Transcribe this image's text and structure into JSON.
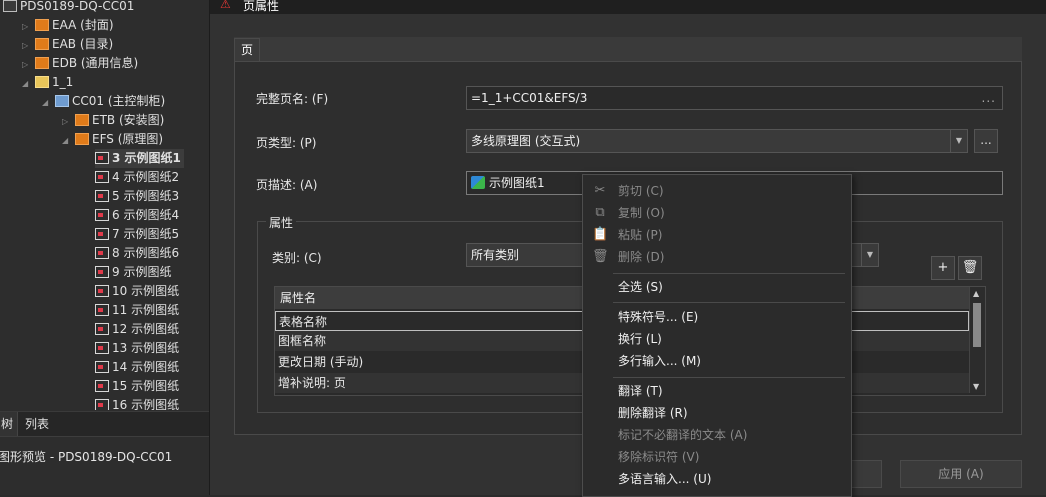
{
  "tree": {
    "nodes": [
      {
        "label": "PDS0189-DQ-CC01",
        "icon": "root-icon",
        "indent": 0,
        "arrow": ""
      },
      {
        "label": "EAA (封面)",
        "icon": "folder-icon",
        "indent": 1,
        "arrow": "▷"
      },
      {
        "label": "EAB (目录)",
        "icon": "folder-icon",
        "indent": 1,
        "arrow": "▷"
      },
      {
        "label": "EDB (通用信息)",
        "icon": "folder-icon",
        "indent": 1,
        "arrow": "▷"
      },
      {
        "label": "1_1",
        "icon": "group-icon",
        "indent": 1,
        "arrow": "◢"
      },
      {
        "label": "CC01 (主控制柜)",
        "icon": "blue-icon",
        "indent": 2,
        "arrow": "◢"
      },
      {
        "label": "ETB (安装图)",
        "icon": "folder-icon",
        "indent": 3,
        "arrow": "▷"
      },
      {
        "label": "EFS (原理图)",
        "icon": "folder-icon",
        "indent": 3,
        "arrow": "◢"
      },
      {
        "label": "3 示例图纸1",
        "icon": "page-icon",
        "indent": 4,
        "arrow": "",
        "selected": true
      },
      {
        "label": "4 示例图纸2",
        "icon": "page-icon",
        "indent": 4,
        "arrow": ""
      },
      {
        "label": "5 示例图纸3",
        "icon": "page-icon",
        "indent": 4,
        "arrow": ""
      },
      {
        "label": "6 示例图纸4",
        "icon": "page-icon",
        "indent": 4,
        "arrow": ""
      },
      {
        "label": "7 示例图纸5",
        "icon": "page-icon",
        "indent": 4,
        "arrow": ""
      },
      {
        "label": "8 示例图纸6",
        "icon": "page-icon",
        "indent": 4,
        "arrow": ""
      },
      {
        "label": "9 示例图纸",
        "icon": "page-icon",
        "indent": 4,
        "arrow": ""
      },
      {
        "label": "10 示例图纸",
        "icon": "page-icon",
        "indent": 4,
        "arrow": ""
      },
      {
        "label": "11 示例图纸",
        "icon": "page-icon",
        "indent": 4,
        "arrow": ""
      },
      {
        "label": "12 示例图纸",
        "icon": "page-icon",
        "indent": 4,
        "arrow": ""
      },
      {
        "label": "13 示例图纸",
        "icon": "page-icon",
        "indent": 4,
        "arrow": ""
      },
      {
        "label": "14 示例图纸",
        "icon": "page-icon",
        "indent": 4,
        "arrow": ""
      },
      {
        "label": "15 示例图纸",
        "icon": "page-icon",
        "indent": 4,
        "arrow": ""
      },
      {
        "label": "16 示例图纸",
        "icon": "page-icon",
        "indent": 4,
        "arrow": ""
      }
    ],
    "tab_tree": "树",
    "tab_list": "列表",
    "preview_title": "图形预览 - PDS0189-DQ-CC01"
  },
  "dialog": {
    "title": "页属性",
    "tab_label": "页",
    "fullname_label": "完整页名: (F)",
    "fullname_value": "=1_1+CC01&EFS/3",
    "fullname_dots": "...",
    "pagetype_label": "页类型: (P)",
    "pagetype_value": "多线原理图 (交互式)",
    "pagetype_more": "...",
    "desc_label": "页描述: (A)",
    "desc_value": "示例图纸1",
    "props_label": "属性",
    "category_label": "类别: (C)",
    "category_value": "所有类别",
    "add_symbol": "+",
    "table_header": "属性名",
    "table_rows": [
      "表格名称",
      "图框名称",
      "更改日期 (手动)",
      "增补说明: 页"
    ],
    "apply_label": "应用 (A)"
  },
  "context_menu": {
    "items": [
      {
        "label": "剪切 (C)",
        "icon": "scissors-icon",
        "disabled": true
      },
      {
        "label": "复制 (O)",
        "icon": "copy-icon",
        "disabled": true
      },
      {
        "label": "粘贴 (P)",
        "icon": "paste-icon",
        "disabled": true
      },
      {
        "label": "删除 (D)",
        "icon": "trash-icon",
        "disabled": true
      },
      {
        "label": "全选 (S)",
        "disabled": false
      },
      {
        "label": "特殊符号... (E)",
        "disabled": false
      },
      {
        "label": "换行 (L)",
        "disabled": false
      },
      {
        "label": "多行输入... (M)",
        "disabled": false
      },
      {
        "label": "翻译 (T)",
        "disabled": false
      },
      {
        "label": "删除翻译 (R)",
        "disabled": false
      },
      {
        "label": "标记不必翻译的文本 (A)",
        "disabled": true
      },
      {
        "label": "移除标识符 (V)",
        "disabled": true
      },
      {
        "label": "多语言输入... (U)",
        "disabled": false
      }
    ]
  }
}
